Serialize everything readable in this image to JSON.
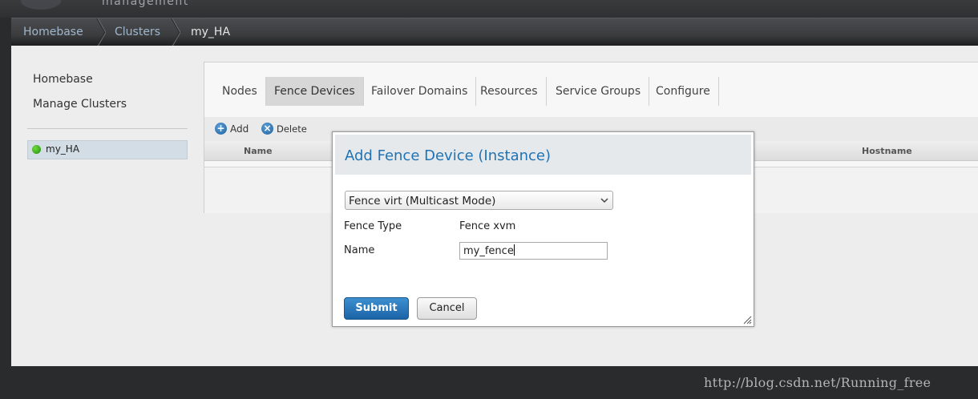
{
  "header": {
    "logo_text": "management"
  },
  "breadcrumb": [
    "Homebase",
    "Clusters",
    "my_HA"
  ],
  "sidebar": {
    "links": [
      "Homebase",
      "Manage Clusters"
    ],
    "clusters": [
      {
        "name": "my_HA",
        "status": "online"
      }
    ]
  },
  "tabs": [
    "Nodes",
    "Fence Devices",
    "Failover Domains",
    "Resources",
    "Service Groups",
    "Configure"
  ],
  "active_tab": "Fence Devices",
  "toolbar": {
    "add_label": "Add",
    "delete_label": "Delete"
  },
  "table": {
    "columns": [
      "Name",
      "Hostname"
    ]
  },
  "dialog": {
    "title": "Add Fence Device (Instance)",
    "select_value": "Fence virt (Multicast Mode)",
    "fence_type_label": "Fence Type",
    "fence_type_value": "Fence xvm",
    "name_label": "Name",
    "name_value": "my_fence",
    "submit_label": "Submit",
    "cancel_label": "Cancel"
  },
  "watermark": "http://blog.csdn.net/Running_free",
  "colors": {
    "accent": "#1f73b4",
    "submit_button": "#1a63a6",
    "status_online": "#2fa51c"
  }
}
